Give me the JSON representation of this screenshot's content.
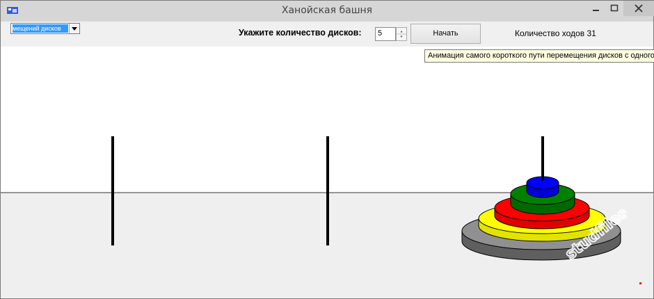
{
  "window": {
    "title": "Ханойская башня",
    "minimize_glyph": "–",
    "maximize_glyph": "□",
    "close_glyph": "✕"
  },
  "toolbar": {
    "select_value": "мещений дисков",
    "disk_label": "Укажите количество дисков:",
    "disk_count": "5",
    "start_label": "Начать",
    "moves_label": "Количество ходов",
    "moves_value": "31"
  },
  "tooltip": "Анимация самого короткого пути перемещения дисков с одного",
  "scene": {
    "peg_count": 3,
    "disks_on_peg": 3,
    "disks": [
      {
        "color": "#808080",
        "size": 5
      },
      {
        "color": "#ffff00",
        "size": 4
      },
      {
        "color": "#ff0000",
        "size": 3
      },
      {
        "color": "#008000",
        "size": 2
      },
      {
        "color": "#0000ff",
        "size": 1
      }
    ]
  },
  "watermark": "studfiles"
}
